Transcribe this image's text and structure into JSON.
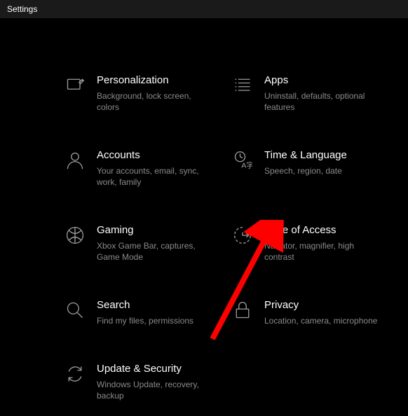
{
  "window": {
    "title": "Settings"
  },
  "categories": {
    "personalization": {
      "title": "Personalization",
      "desc": "Background, lock screen, colors"
    },
    "apps": {
      "title": "Apps",
      "desc": "Uninstall, defaults, optional features"
    },
    "accounts": {
      "title": "Accounts",
      "desc": "Your accounts, email, sync, work, family"
    },
    "time_language": {
      "title": "Time & Language",
      "desc": "Speech, region, date"
    },
    "gaming": {
      "title": "Gaming",
      "desc": "Xbox Game Bar, captures, Game Mode"
    },
    "ease_of_access": {
      "title": "Ease of Access",
      "desc": "Narrator, magnifier, high contrast"
    },
    "search": {
      "title": "Search",
      "desc": "Find my files, permissions"
    },
    "privacy": {
      "title": "Privacy",
      "desc": "Location, camera, microphone"
    },
    "update_security": {
      "title": "Update & Security",
      "desc": "Windows Update, recovery, backup"
    }
  },
  "annotation": {
    "arrow_target": "ease_of_access",
    "arrow_color": "#ff0000"
  }
}
